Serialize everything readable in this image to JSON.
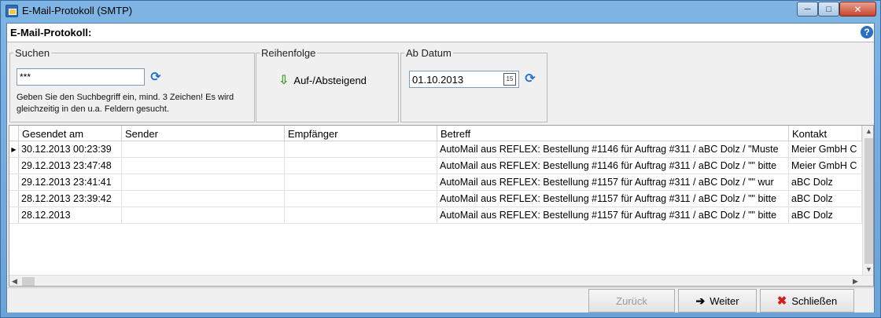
{
  "window": {
    "title": "E-Mail-Protokoll (SMTP)"
  },
  "header": {
    "title": "E-Mail-Protokoll:"
  },
  "search": {
    "legend": "Suchen",
    "value": "***",
    "hint": "Geben Sie den Suchbegriff ein, mind. 3 Zeichen! Es wird gleichzeitig in den u.a. Feldern gesucht."
  },
  "order": {
    "legend": "Reihenfolge",
    "label": "Auf-/Absteigend"
  },
  "date": {
    "legend": "Ab Datum",
    "value": "01.10.2013",
    "calendar_label": "15"
  },
  "table": {
    "columns": [
      "Gesendet am",
      "Sender",
      "Empfänger",
      "Betreff",
      "Kontakt"
    ],
    "rows": [
      {
        "sent": "30.12.2013 00:23:39",
        "sender": "",
        "recipient": "",
        "subject": "AutoMail aus REFLEX: Bestellung #1146 für Auftrag #311 / aBC Dolz / \"Muste",
        "contact": "Meier GmbH  C"
      },
      {
        "sent": "29.12.2013 23:47:48",
        "sender": "",
        "recipient": "",
        "subject": "AutoMail aus REFLEX: Bestellung #1146 für Auftrag #311 / aBC Dolz / \"\" bitte",
        "contact": "Meier GmbH  C"
      },
      {
        "sent": "29.12.2013 23:41:41",
        "sender": "",
        "recipient": "",
        "subject": "AutoMail aus REFLEX: Bestellung #1157 für Auftrag #311 / aBC Dolz / \"\" wur",
        "contact": "aBC Dolz"
      },
      {
        "sent": "28.12.2013 23:39:42",
        "sender": "",
        "recipient": "",
        "subject": "AutoMail aus REFLEX: Bestellung #1157 für Auftrag #311 / aBC Dolz / \"\" bitte",
        "contact": "aBC Dolz"
      },
      {
        "sent": "28.12.2013",
        "sender": "",
        "recipient": "",
        "subject": "AutoMail aus REFLEX: Bestellung #1157 für Auftrag #311 / aBC Dolz / \"\" bitte",
        "contact": "aBC Dolz"
      }
    ]
  },
  "footer": {
    "back_label": "Zurück",
    "next_label": "Weiter",
    "close_label": "Schließen"
  },
  "icons": {
    "app": "mail-app-icon",
    "help": "help-icon",
    "refresh": "refresh-icon",
    "order": "arrow-down-icon",
    "calendar": "calendar-icon",
    "next": "arrow-right-icon",
    "close": "x-icon"
  },
  "colors": {
    "titlebar": "#6fa8dc",
    "refresh": "#1e6fd0",
    "order_arrow": "#3e9d1b",
    "close_x": "#d41f1f"
  }
}
